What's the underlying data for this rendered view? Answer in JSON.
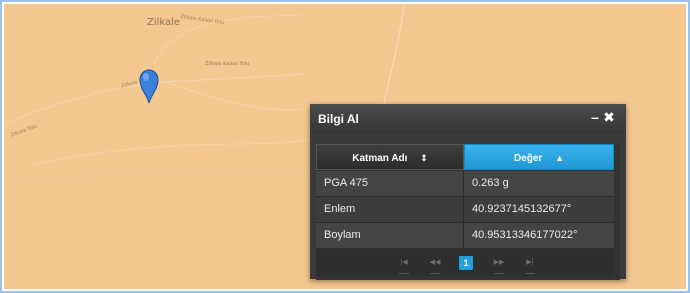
{
  "map": {
    "place_label": "Zilkale",
    "road_labels": [
      "Zilkale Kalesi Yolu",
      "Zilkale Kalesi Yolu",
      "Zilkale Yolu",
      "Zilkale Yolu"
    ]
  },
  "info_window": {
    "title": "Bilgi Al",
    "minimize_symbol": "–",
    "close_symbol": "✖",
    "columns": {
      "name": "Katman Adı",
      "name_sort_icon": "⇕",
      "value": "Değer",
      "value_sort_icon": "▲"
    },
    "rows": [
      {
        "name": "PGA 475",
        "value": "0.263 g"
      },
      {
        "name": "Enlem",
        "value": "40.9237145132677°"
      },
      {
        "name": "Boylam",
        "value": "40.95313346177022°"
      }
    ],
    "pager": {
      "first": "|◀",
      "prev": "◀◀",
      "current_page": "1",
      "next": "▶▶",
      "last": "▶|"
    }
  },
  "colors": {
    "map_background": "#f6c891",
    "accent": "#23a1df",
    "pin": "#3a7fd8",
    "panel": "#3a3a3a"
  },
  "icons": {
    "pin": "map-marker-icon",
    "minimize": "minimize-icon",
    "close": "close-icon"
  }
}
